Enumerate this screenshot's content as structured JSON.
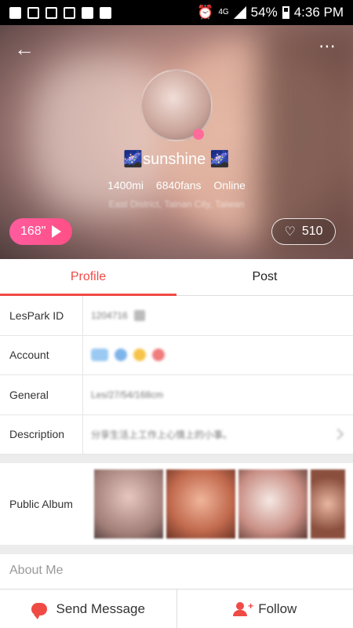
{
  "status_bar": {
    "network": "4G",
    "battery": "54%",
    "time": "4:36 PM"
  },
  "header": {
    "username": "🌌sunshine 🌌",
    "distance": "1400mi",
    "fans": "6840fans",
    "online_status": "Online",
    "location": "East District, Tainan City, Taiwan",
    "voice_duration": "168\"",
    "likes": "510"
  },
  "tabs": [
    {
      "label": "Profile",
      "active": true
    },
    {
      "label": "Post",
      "active": false
    }
  ],
  "info_rows": [
    {
      "label": "LesPark ID",
      "value": "1204716"
    },
    {
      "label": "Account",
      "value": ""
    },
    {
      "label": "General",
      "value": "Les/27/54/168cm"
    },
    {
      "label": "Description",
      "value": "分享生活上工作上心情上的小事。"
    }
  ],
  "album": {
    "label": "Public Album"
  },
  "about": {
    "label": "About Me"
  },
  "bottom_bar": {
    "message_label": "Send Message",
    "follow_label": "Follow"
  }
}
